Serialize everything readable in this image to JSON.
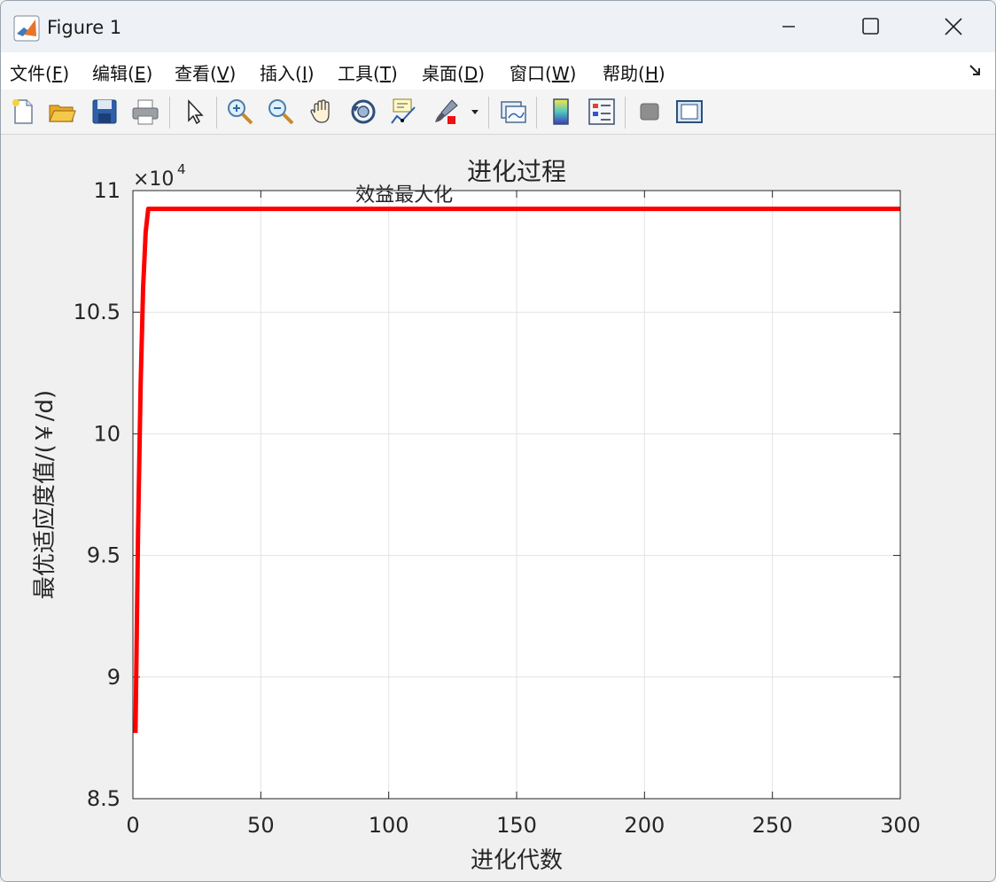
{
  "window": {
    "title": "Figure 1"
  },
  "menu": [
    {
      "label": "文件(",
      "key": "F",
      "end": ")"
    },
    {
      "label": "编辑(",
      "key": "E",
      "end": ")"
    },
    {
      "label": "查看(",
      "key": "V",
      "end": ")"
    },
    {
      "label": "插入(",
      "key": "I",
      "end": ")"
    },
    {
      "label": "工具(",
      "key": "T",
      "end": ")"
    },
    {
      "label": "桌面(",
      "key": "D",
      "end": ")"
    },
    {
      "label": "窗口(",
      "key": "W",
      "end": ")"
    },
    {
      "label": "帮助(",
      "key": "H",
      "end": ")"
    }
  ],
  "menu_corner_icon": "dock-arrow-icon",
  "toolbar_icons": [
    "new-figure-icon",
    "open-file-icon",
    "save-icon",
    "print-icon",
    "select-pointer-icon",
    "zoom-in-icon",
    "zoom-out-icon",
    "pan-hand-icon",
    "rotate-3d-icon",
    "data-cursor-icon",
    "brush-icon",
    "link-plot-icon",
    "colorbar-icon",
    "legend-icon",
    "hide-plot-tools-icon",
    "show-plot-tools-icon"
  ],
  "chart_data": {
    "type": "line",
    "title": "进化过程",
    "xlabel": "进化代数",
    "ylabel": "最优适应度值/(￥/d)",
    "exponent_label": "×10",
    "exponent_power": "4",
    "xlim": [
      0,
      300
    ],
    "ylim": [
      85000,
      110000
    ],
    "xticks": [
      0,
      50,
      100,
      150,
      200,
      250,
      300
    ],
    "xtick_labels": [
      "0",
      "50",
      "100",
      "150",
      "200",
      "250",
      "300"
    ],
    "yticks": [
      85000,
      90000,
      95000,
      100000,
      105000,
      110000
    ],
    "ytick_labels": [
      "8.5",
      "9",
      "9.5",
      "10",
      "10.5",
      "11"
    ],
    "grid": true,
    "annotation": "效益最大化",
    "annotation_at": [
      87,
      109700
    ],
    "series": [
      {
        "color": "#ff0000",
        "x": [
          1,
          2,
          3,
          4,
          5,
          6,
          300
        ],
        "y": [
          87700,
          96000,
          102000,
          106000,
          108300,
          109250,
          109250
        ]
      }
    ]
  }
}
